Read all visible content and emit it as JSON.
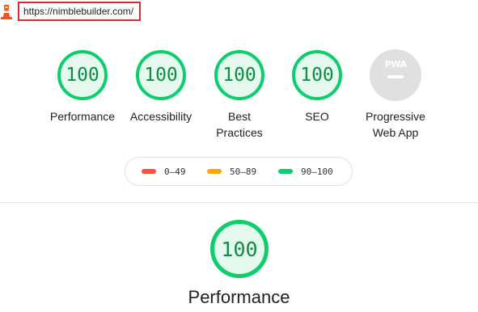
{
  "header": {
    "url": "https://nimblebuilder.com/",
    "icon": "lighthouse-icon"
  },
  "colors": {
    "pass": "#0cce6b",
    "pass_text": "#0c8f45",
    "pass_fill": "#e6f9ee",
    "average": "#ffa400",
    "fail": "#ff4e42",
    "pwa_gray": "#e0e0e0",
    "highlight": "#d32f2f"
  },
  "scores": [
    {
      "label": "Performance",
      "value": "100",
      "fraction": 1.0
    },
    {
      "label": "Accessibility",
      "value": "100",
      "fraction": 1.0
    },
    {
      "label": "Best Practices",
      "label_line1": "Best",
      "label_line2": "Practices",
      "value": "100",
      "fraction": 1.0
    },
    {
      "label": "SEO",
      "value": "100",
      "fraction": 1.0
    }
  ],
  "pwa": {
    "badge_text": "PWA",
    "label_line1": "Progressive",
    "label_line2": "Web App"
  },
  "legend": [
    {
      "range": "0–49",
      "color": "#ff4e42"
    },
    {
      "range": "50–89",
      "color": "#ffa400"
    },
    {
      "range": "90–100",
      "color": "#0cce6b"
    }
  ],
  "performance_section": {
    "score": "100",
    "fraction": 1.0,
    "title": "Performance"
  }
}
